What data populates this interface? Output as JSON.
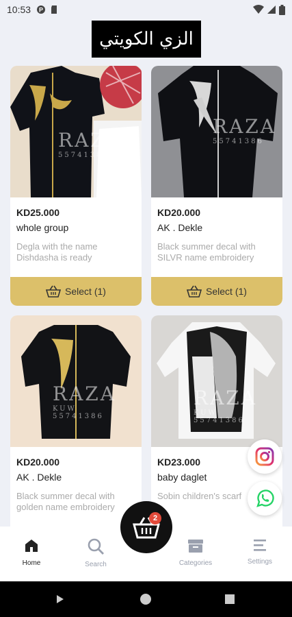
{
  "status_bar": {
    "time": "10:53"
  },
  "header": {
    "logo_text": "الزي الكويتي"
  },
  "products": [
    {
      "price": "KD25.000",
      "name": "whole group",
      "description": "Degla with the name Dishdasha is ready",
      "select_label": "Select (1)",
      "watermark": "RAZA",
      "watermark_sub": "55741386"
    },
    {
      "price": "KD20.000",
      "name": "AK . Dekle",
      "description": "Black summer decal with SILVR name embroidery",
      "select_label": "Select (1)",
      "watermark": "RAZA",
      "watermark_sub": "55741386"
    },
    {
      "price": "KD20.000",
      "name": "AK . Dekle",
      "description": "Black summer decal with golden name embroidery",
      "watermark": "RAZA",
      "watermark_sub": "55741386",
      "watermark_mid": "KUW"
    },
    {
      "price": "KD23.000",
      "name": "baby daglet",
      "description": "Sobin children's scarf",
      "watermark": "RAZA",
      "watermark_sub": "55741386",
      "watermark_mid": "KUW"
    }
  ],
  "cart": {
    "badge_count": "2"
  },
  "bottom_nav": [
    {
      "label": "Home"
    },
    {
      "label": "Search"
    },
    {
      "label": "Categories"
    },
    {
      "label": "Settings"
    }
  ],
  "colors": {
    "accent": "#dcc06a",
    "background": "#eef0f6",
    "badge": "#e34a3a"
  },
  "icons": [
    "instagram-icon",
    "whatsapp-icon",
    "basket-icon",
    "home-icon",
    "search-icon",
    "categories-icon",
    "settings-icon"
  ]
}
